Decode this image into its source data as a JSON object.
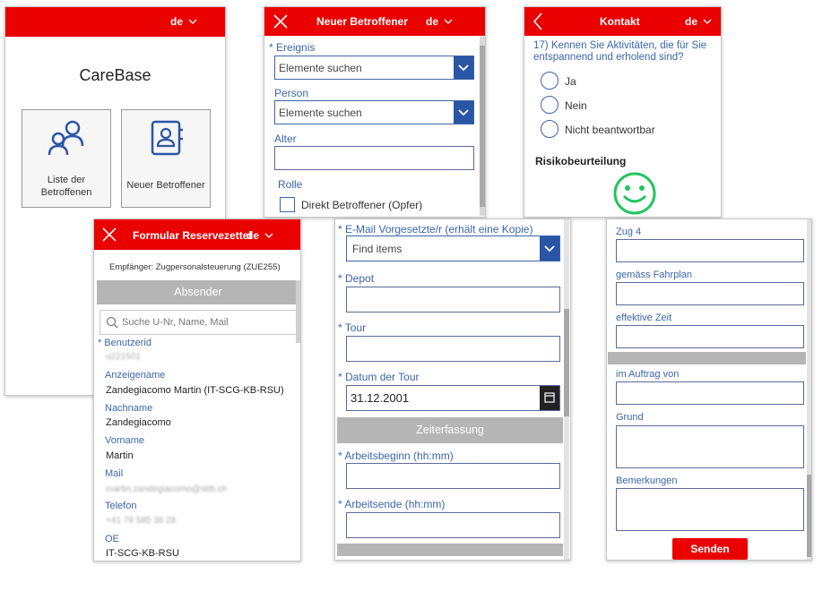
{
  "lang": "de",
  "p1": {
    "title": "CareBase",
    "tile1_label": "Liste der Betroffenen",
    "tile2_label": "Neuer Betroffener"
  },
  "p2": {
    "title": "Neuer Betroffener",
    "ereignis_label": "Ereignis",
    "ereignis_placeholder": "Elemente suchen",
    "person_label": "Person",
    "person_placeholder": "Elemente suchen",
    "alter_label": "Alter",
    "rolle_label": "Rolle",
    "rolle_option": "Direkt Betroffener (Opfer)"
  },
  "p3": {
    "title": "Kontakt",
    "question": "17) Kennen Sie Aktivitäten, die für Sie entspannend und erholend sind?",
    "options": [
      "Ja",
      "Nein",
      "Nicht beantwortbar"
    ],
    "risk_title": "Risikobeurteilung"
  },
  "p4": {
    "title": "Formular Reservezettel",
    "recipient": "Empfänger:  Zugpersonalsteuerung (ZUE255)",
    "section": "Absender",
    "search_placeholder": "Suche U-Nr, Name, Mail",
    "benutzerid_label": "Benutzerid",
    "benutzerid_value": "u221501",
    "anzeigename_label": "Anzeigename",
    "anzeigename_value": "Zandegiacomo Martin (IT-SCG-KB-RSU)",
    "nachname_label": "Nachname",
    "nachname_value": "Zandegiacomo",
    "vorname_label": "Vorname",
    "vorname_value": "Martin",
    "mail_label": "Mail",
    "mail_value": "martin.zandegiacomo@sbb.ch",
    "telefon_label": "Telefon",
    "telefon_value": "+41 79 585 38 28",
    "oe_label": "OE",
    "oe_value": "IT-SCG-KB-RSU"
  },
  "p5": {
    "email_label": "E-Mail Vorgesetzte/r (erhält eine Kopie)",
    "email_placeholder": "Find items",
    "depot_label": "Depot",
    "tour_label": "Tour",
    "datum_label": "Datum der Tour",
    "datum_value": "31.12.2001",
    "section": "Zeiterfassung",
    "beginn_label": "Arbeitsbeginn (hh:mm)",
    "ende_label": "Arbeitsende (hh:mm)"
  },
  "p6": {
    "zug_label": "Zug 4",
    "fahrplan_label": "gemäss Fahrplan",
    "effektiv_label": "effektive Zeit",
    "auftrag_label": "im Auftrag von",
    "grund_label": "Grund",
    "bemerkungen_label": "Bemerkungen",
    "send_label": "Senden"
  },
  "colors": {
    "accent": "#eb0000",
    "primary": "#2b56a6",
    "smiley": "#22c55e"
  }
}
